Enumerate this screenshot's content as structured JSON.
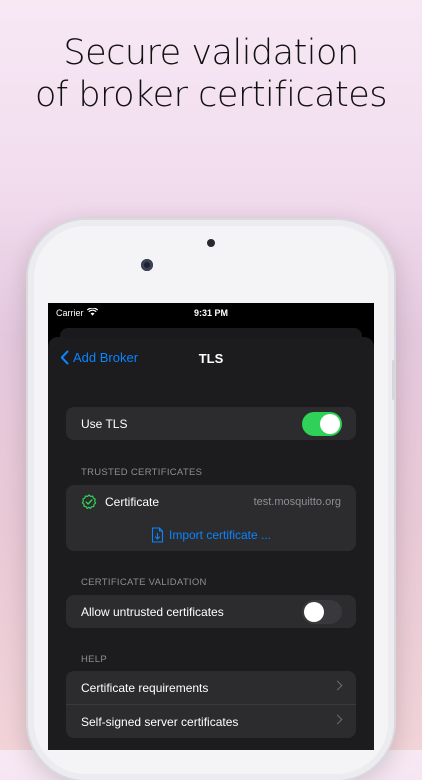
{
  "headline": {
    "line1": "Secure validation",
    "line2": "of broker certificates"
  },
  "status": {
    "carrier": "Carrier",
    "time": "9:31 PM"
  },
  "nav": {
    "back_label": "Add Broker",
    "title": "TLS"
  },
  "use_tls": {
    "label": "Use TLS",
    "on": true
  },
  "trusted": {
    "header": "TRUSTED CERTIFICATES",
    "cert_label": "Certificate",
    "cert_host": "test.mosquitto.org",
    "import_label": "Import certificate ..."
  },
  "validation": {
    "header": "CERTIFICATE VALIDATION",
    "allow_label": "Allow untrusted certificates",
    "allow_on": false
  },
  "help": {
    "header": "HELP",
    "items": [
      "Certificate requirements",
      "Self-signed server certificates"
    ]
  },
  "colors": {
    "accent": "#0a84ff",
    "toggle_on": "#30d158",
    "toggle_off": "#39393d",
    "check": "#30d158"
  }
}
